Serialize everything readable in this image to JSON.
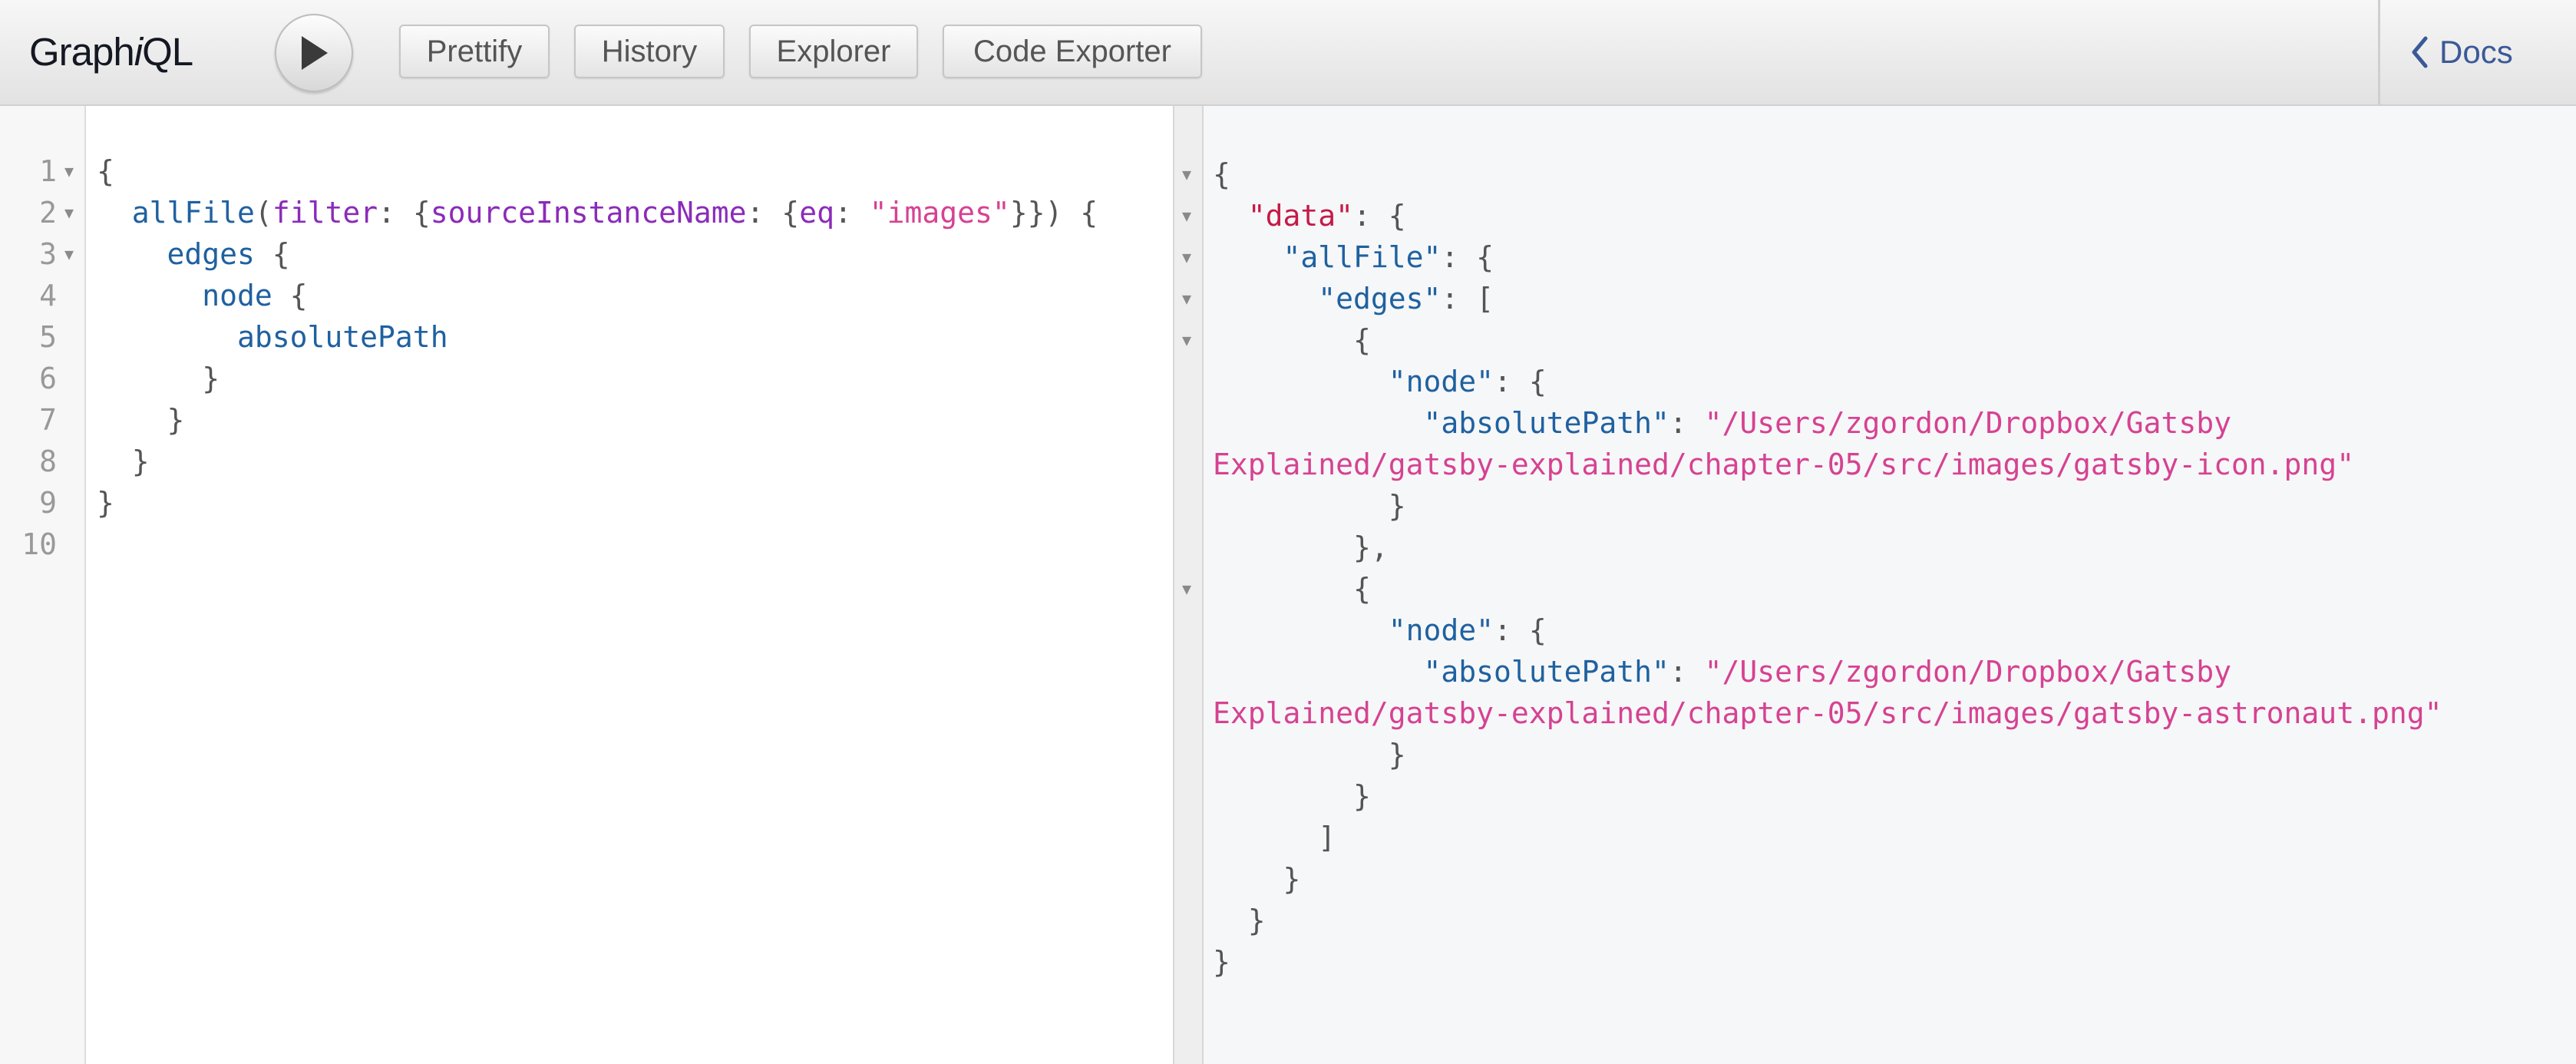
{
  "app": {
    "title_prefix": "Graph",
    "title_italic": "i",
    "title_suffix": "QL"
  },
  "toolbar": {
    "run_label": "",
    "buttons": [
      "Prettify",
      "History",
      "Explorer",
      "Code Exporter"
    ],
    "docs_label": "Docs"
  },
  "editor": {
    "line_numbers": [
      "1",
      "2",
      "3",
      "4",
      "5",
      "6",
      "7",
      "8",
      "9",
      "10"
    ],
    "lines": {
      "l1_brace": "{",
      "l2_field": "allFile",
      "l2_paren_open": "(",
      "l2_arg": "filter",
      "l2_colon1": ": {",
      "l2_arg2": "sourceInstanceName",
      "l2_colon2": ": {",
      "l2_arg3": "eq",
      "l2_colon3": ": ",
      "l2_str": "\"images\"",
      "l2_close": "}}) {",
      "l3_field": "edges",
      "l3_brace": " {",
      "l4_field": "node",
      "l4_brace": " {",
      "l5_field": "absolutePath",
      "l6": "}",
      "l7": "}",
      "l8": "}",
      "l9": "}"
    }
  },
  "result": {
    "open_brace": "{",
    "data_key": "\"data\"",
    "allfile_key": "\"allFile\"",
    "edges_key": "\"edges\"",
    "open_bracket": "[",
    "node_key": "\"node\"",
    "abs_key": "\"absolutePath\"",
    "path1_part1": "\"/Users/zgordon/Dropbox/Gatsby",
    "path1_part2": "Explained/gatsby-explained/chapter-05/src/images/gatsby-icon.png\"",
    "path2_part1": "\"/Users/zgordon/Dropbox/Gatsby",
    "path2_part2": "Explained/gatsby-explained/chapter-05/src/images/gatsby-astronaut.png\"",
    "colon_brace": ": {",
    "colon_bracket": ": [",
    "colon": ": ",
    "close_brace": "}",
    "close_brace_comma": "},",
    "close_bracket": "]"
  }
}
